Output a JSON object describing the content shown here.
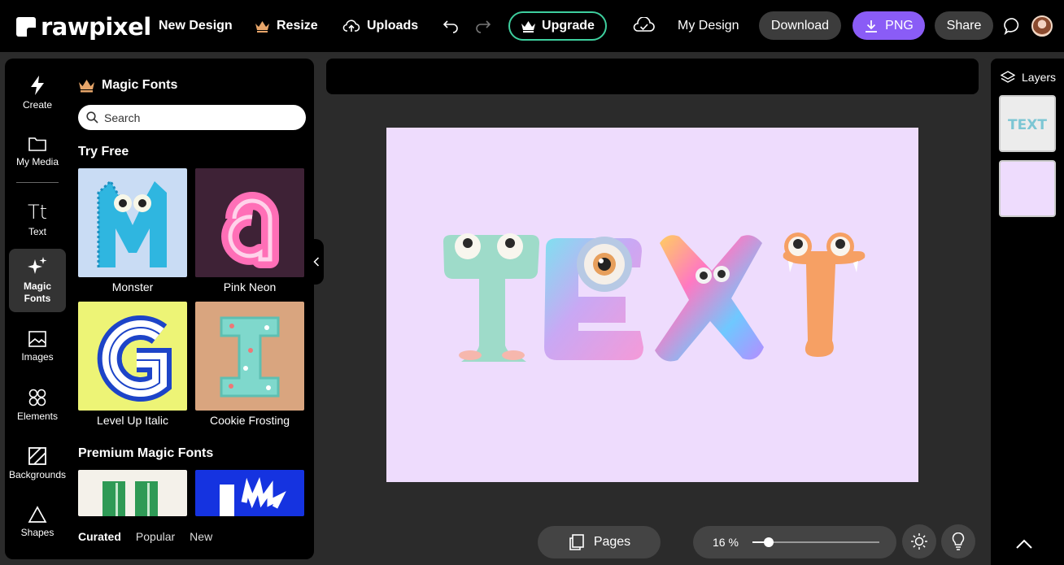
{
  "topbar": {
    "logo": "rawpixel",
    "new_design": "New Design",
    "resize": "Resize",
    "uploads": "Uploads",
    "upgrade": "Upgrade",
    "my_design": "My Design",
    "download": "Download",
    "png": "PNG",
    "share": "Share"
  },
  "rail": [
    {
      "label": "Create",
      "icon": "lightning-icon"
    },
    {
      "label": "My Media",
      "icon": "folder-icon"
    },
    {
      "label": "Text",
      "icon": "text-icon"
    },
    {
      "label": "Magic Fonts",
      "icon": "sparkle-icon"
    },
    {
      "label": "Images",
      "icon": "image-icon"
    },
    {
      "label": "Elements",
      "icon": "elements-icon"
    },
    {
      "label": "Backgrounds",
      "icon": "background-icon"
    },
    {
      "label": "Shapes",
      "icon": "triangle-icon"
    }
  ],
  "panel": {
    "title": "Magic Fonts",
    "search_placeholder": "Search",
    "try_free": "Try Free",
    "fonts_free": [
      {
        "label": "Monster"
      },
      {
        "label": "Pink Neon"
      },
      {
        "label": "Level Up Italic"
      },
      {
        "label": "Cookie Frosting"
      }
    ],
    "premium": "Premium Magic Fonts",
    "tabs": [
      "Curated",
      "Popular",
      "New"
    ]
  },
  "canvas": {
    "text": "TEXT",
    "background": "#eedcfd"
  },
  "bottom": {
    "pages": "Pages",
    "zoom": "16 %",
    "zoom_level": 0.13
  },
  "right": {
    "layers": "Layers",
    "thumb1_text": "TEXT"
  },
  "colors": {
    "accent": "#8a5cf6",
    "upgrade_border": "#3ecf9e"
  }
}
